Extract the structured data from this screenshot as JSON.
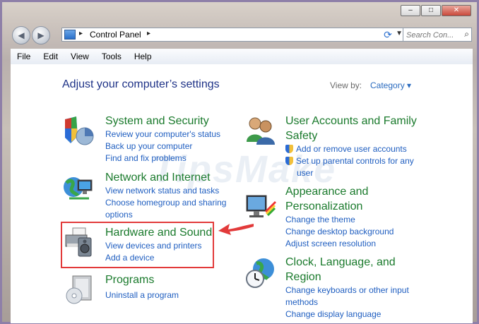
{
  "address": {
    "root_arrow": "▸",
    "path": "Control Panel",
    "after_arrow": "▸"
  },
  "search": {
    "placeholder": "Search Con..."
  },
  "menu": [
    "File",
    "Edit",
    "View",
    "Tools",
    "Help"
  ],
  "main": {
    "heading": "Adjust your computer’s settings",
    "view_by_label": "View by:",
    "view_by_value": "Category"
  },
  "categories": {
    "system": {
      "title": "System and Security",
      "links": [
        "Review your computer's status",
        "Back up your computer",
        "Find and fix problems"
      ]
    },
    "network": {
      "title": "Network and Internet",
      "links": [
        "View network status and tasks",
        "Choose homegroup and sharing",
        "options"
      ]
    },
    "hardware": {
      "title": "Hardware and Sound",
      "links": [
        "View devices and printers",
        "Add a device"
      ]
    },
    "programs": {
      "title": "Programs",
      "links": [
        "Uninstall a program"
      ]
    },
    "users": {
      "title_line1": "User Accounts and Family",
      "title_line2": "Safety",
      "links": [
        "Add or remove user accounts",
        "Set up parental controls for any",
        "user"
      ]
    },
    "appearance": {
      "title_line1": "Appearance and",
      "title_line2": "Personalization",
      "links": [
        "Change the theme",
        "Change desktop background",
        "Adjust screen resolution"
      ]
    },
    "clock": {
      "title_line1": "Clock, Language, and",
      "title_line2": "Region",
      "links": [
        "Change keyboards or other input",
        "methods",
        "Change display language"
      ]
    }
  },
  "watermark": "TipsMake",
  "colors": {
    "link": "#1f5ec0",
    "category_title": "#1a7a2c",
    "heading": "#1e3287",
    "highlight": "#e23a3a"
  }
}
